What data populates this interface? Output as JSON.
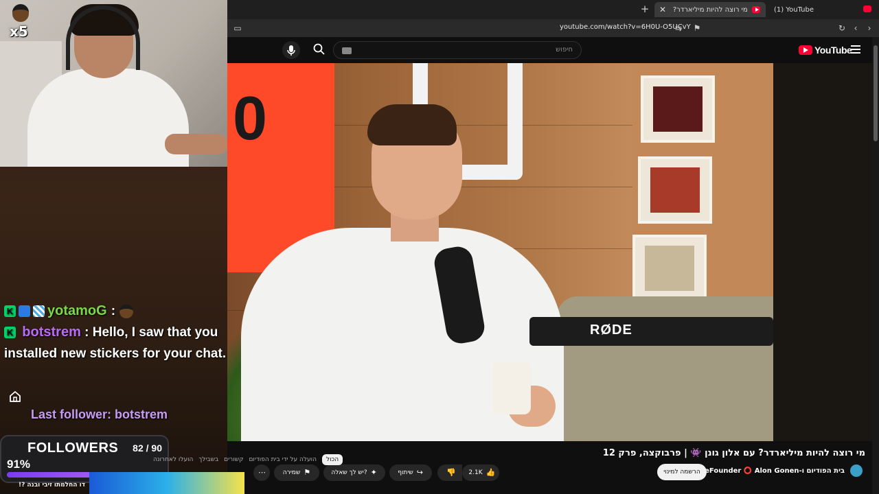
{
  "browser": {
    "tabs": [
      {
        "label": "מי רוצה להיות מיליארדר? עם"
      },
      {
        "label": "(1) YouTube"
      }
    ],
    "url": "youtube.com/watch?v=6H0U-O5UCvY"
  },
  "youtube": {
    "logo_text": "YouTube",
    "search_placeholder": "חיפוש",
    "video_title": "מי רוצה להיות מיליארדר? עם אלון גונן 👾 | פרבוקצה, פרק 12",
    "channel": "בית הפודיום ו-deFounder ⭕ Alon Gonen",
    "subscribe_label": "הרשמה למינוי",
    "like_count": "2.1K",
    "share_label": "שיתוף",
    "ask_label": "יש לך שאלה?",
    "save_label": "שמירה",
    "chips": [
      "הכול",
      "הועלה על ידי בית הפודיום",
      "קשורים",
      "בשבילך",
      "הועלו לאחרונה"
    ],
    "video_overlay_text": "RØDE"
  },
  "stream": {
    "streamer_badge": "x5",
    "chat": [
      {
        "user": "yotamoG",
        "text": ":"
      },
      {
        "user": "botstrem",
        "text": ": Hello, I saw that you installed new stickers for your chat."
      }
    ],
    "last_follower": "Last follower: botstrem",
    "followers": {
      "title": "FOLLOWERS",
      "count": "82 / 90",
      "percent_label": "91%",
      "fraction": 0.91
    },
    "bottom_caption": "דו החלמתו זיבי ובנה ?!"
  },
  "colors": {
    "youtube_red": "#ff0033",
    "chat_green": "#7cd64a",
    "chat_purple": "#b86cf5",
    "follower_purple": "#c89cf2"
  }
}
